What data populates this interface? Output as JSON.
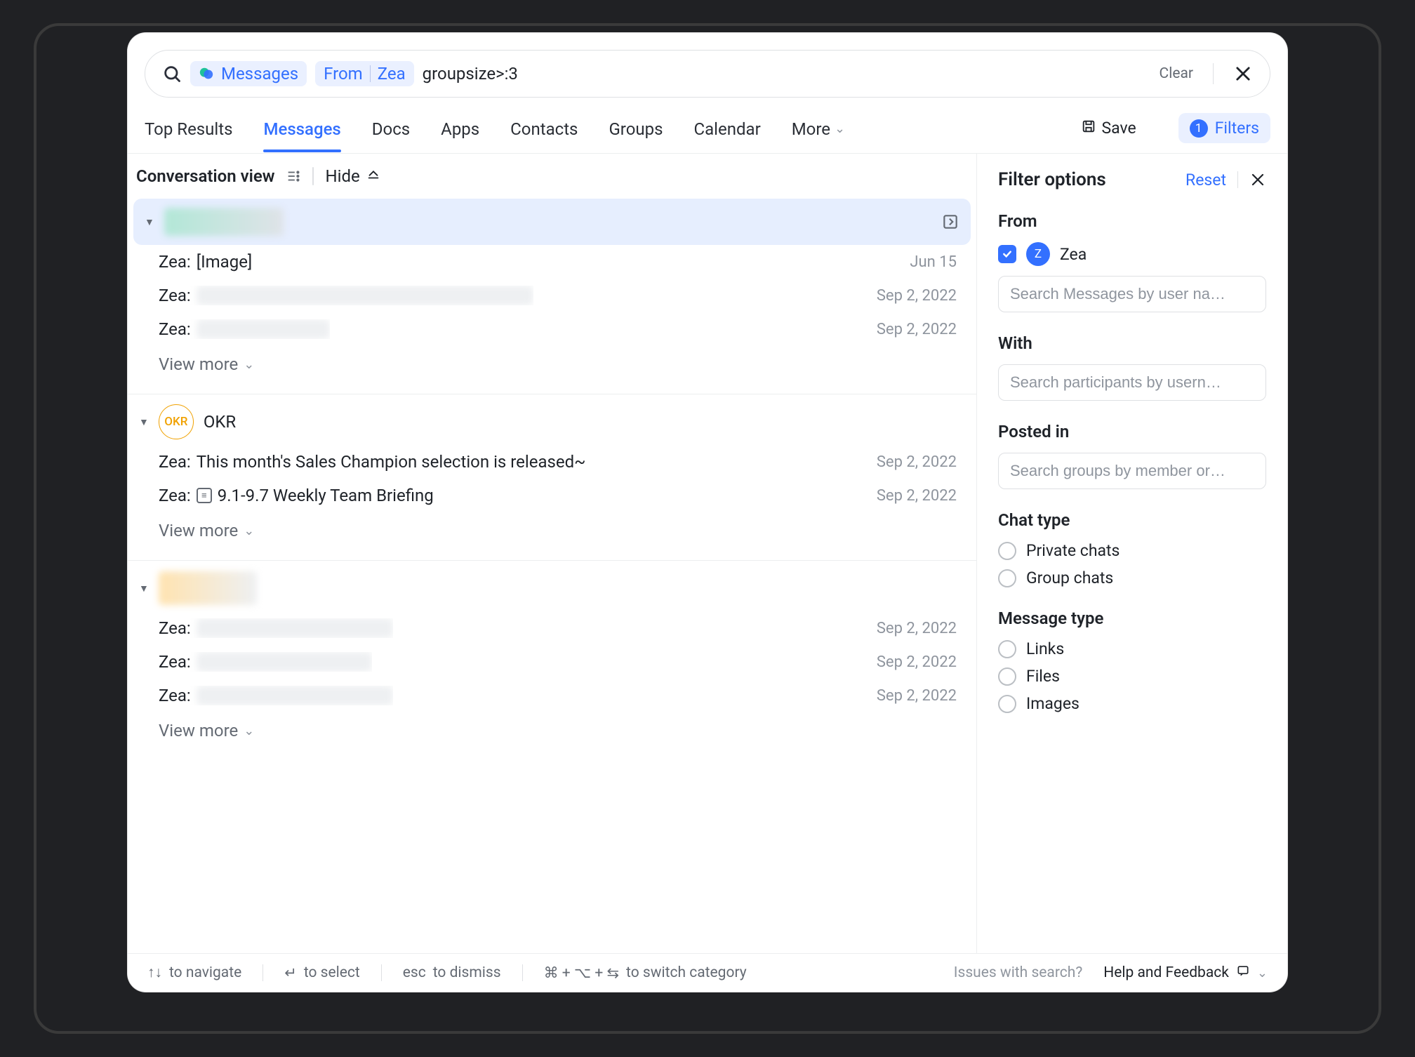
{
  "search": {
    "chip_messages": "Messages",
    "chip_from_label": "From",
    "chip_from_value": "Zea",
    "query_text": "groupsize>:3",
    "clear_label": "Clear"
  },
  "tabs": {
    "top_results": "Top Results",
    "messages": "Messages",
    "docs": "Docs",
    "apps": "Apps",
    "contacts": "Contacts",
    "groups": "Groups",
    "calendar": "Calendar",
    "more": "More",
    "save": "Save",
    "filters_label": "Filters",
    "filters_count": "1"
  },
  "conv_header": {
    "title": "Conversation view",
    "hide_label": "Hide"
  },
  "groups": [
    {
      "id": "g1",
      "highlight": true,
      "name_blurred": true,
      "messages": [
        {
          "author": "Zea:",
          "text": "[Image]",
          "date": "Jun 15",
          "blurred": false
        },
        {
          "author": "Zea:",
          "text": "",
          "date": "Sep 2, 2022",
          "blurred": true,
          "blur_w": 480
        },
        {
          "author": "Zea:",
          "text": "",
          "date": "Sep 2, 2022",
          "blurred": true,
          "blur_w": 190
        }
      ],
      "view_more": "View more"
    },
    {
      "id": "g2",
      "avatar_label": "OKR",
      "name": "OKR",
      "messages": [
        {
          "author": "Zea:",
          "text": "This month's Sales Champion selection is released~",
          "date": "Sep 2, 2022",
          "blurred": false
        },
        {
          "author": "Zea:",
          "text": "9.1-9.7 Weekly Team Briefing",
          "date": "Sep 2, 2022",
          "blurred": false,
          "doc_icon": true
        }
      ],
      "view_more": "View more"
    },
    {
      "id": "g3",
      "name_blurred": true,
      "messages": [
        {
          "author": "Zea:",
          "text": "",
          "date": "Sep 2, 2022",
          "blurred": true,
          "blur_w": 280
        },
        {
          "author": "Zea:",
          "text": "",
          "date": "Sep 2, 2022",
          "blurred": true,
          "blur_w": 250
        },
        {
          "author": "Zea:",
          "text": "",
          "date": "Sep 2, 2022",
          "blurred": true,
          "blur_w": 280
        }
      ],
      "view_more": "View more"
    }
  ],
  "filter_panel": {
    "title": "Filter options",
    "reset": "Reset",
    "from": {
      "label": "From",
      "user_initial": "Z",
      "user_name": "Zea",
      "placeholder": "Search Messages by user na…"
    },
    "with": {
      "label": "With",
      "placeholder": "Search participants by usern…"
    },
    "posted_in": {
      "label": "Posted in",
      "placeholder": "Search groups by member or…"
    },
    "chat_type": {
      "label": "Chat type",
      "options": [
        "Private chats",
        "Group chats"
      ]
    },
    "message_type": {
      "label": "Message type",
      "options": [
        "Links",
        "Files",
        "Images"
      ]
    }
  },
  "footer": {
    "navigate": "to navigate",
    "select": "to select",
    "esc": "esc",
    "dismiss": "to dismiss",
    "switch_keys": "⌘ + ⌥ + ⇆",
    "switch_label": "to switch category",
    "issue_label": "Issues with search?",
    "help_label": "Help and Feedback"
  }
}
